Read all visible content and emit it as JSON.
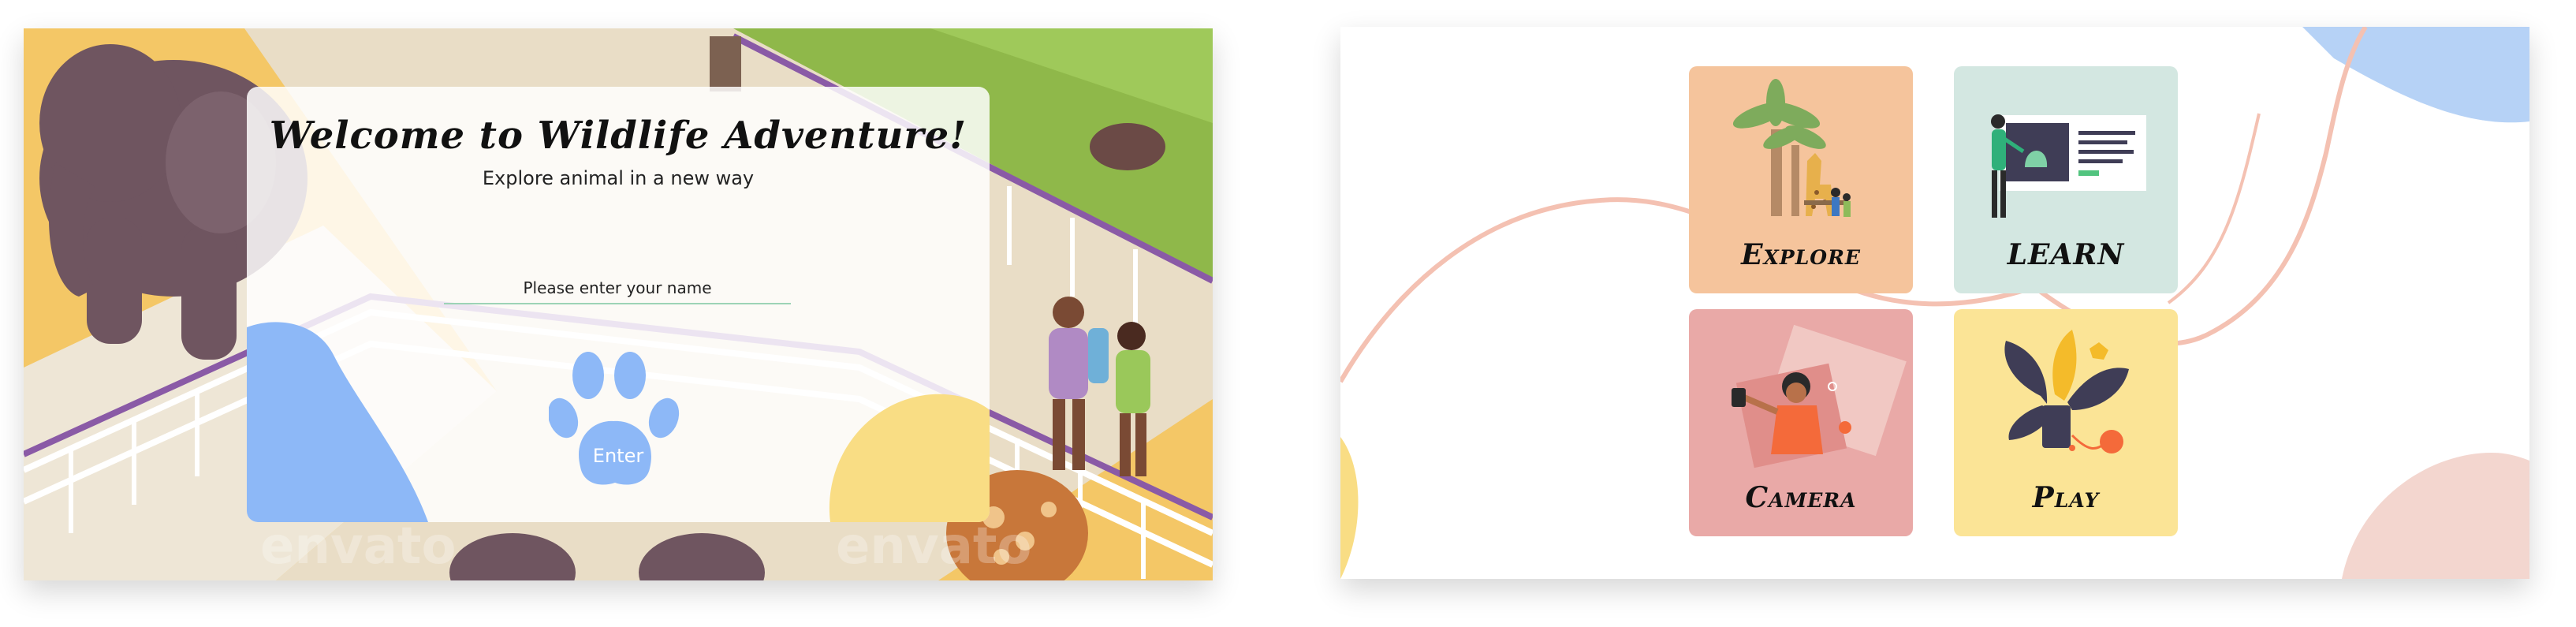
{
  "welcome_screen": {
    "title": "Welcome to Wildlife Adventure!",
    "subtitle": "Explore animal in a new way",
    "name_input": {
      "placeholder": "Please enter your name",
      "value": ""
    },
    "enter_button_label": "Enter",
    "watermark_text": "envato"
  },
  "menu_screen": {
    "tiles": [
      {
        "label": "Explore",
        "color": "#f5c49c",
        "illustration": "palm-tree-giraffe-illustration"
      },
      {
        "label": "LEARN",
        "color": "#d3e7e1",
        "illustration": "presentation-board-illustration"
      },
      {
        "label": "Camera",
        "color": "#e9a9a7",
        "illustration": "selfie-camera-illustration"
      },
      {
        "label": "Play",
        "color": "#fbe496",
        "illustration": "plant-play-illustration"
      }
    ]
  },
  "colors": {
    "accent_blue": "#8db8f7",
    "blob_yellow": "#f9dd84",
    "line_pink": "#f4c1b2",
    "input_underline": "#9cd3b6",
    "grass_green": "#8fb84a"
  }
}
